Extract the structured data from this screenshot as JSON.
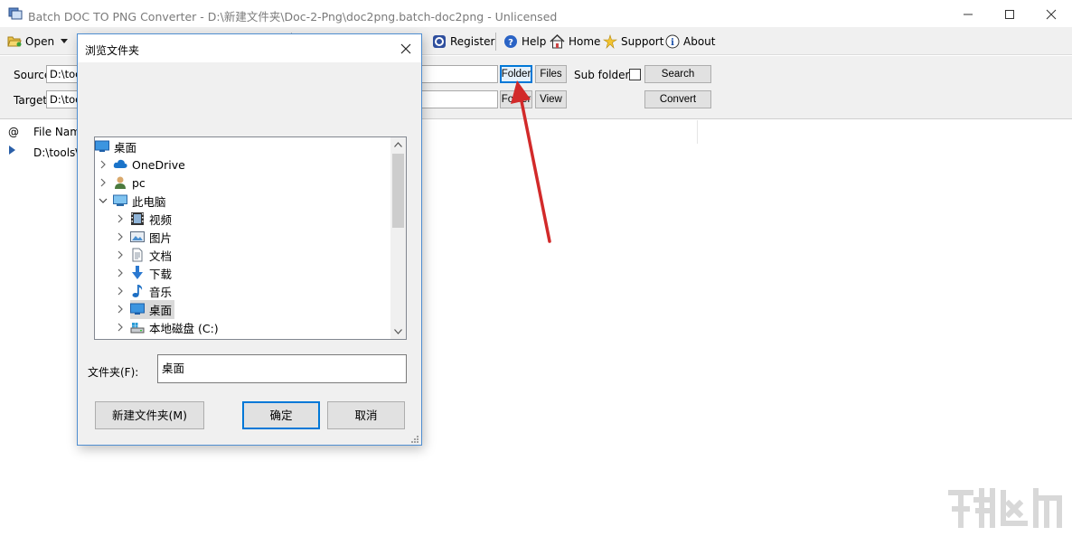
{
  "window": {
    "title": "Batch DOC TO PNG Converter - D:\\新建文件夹\\Doc-2-Png\\doc2png.batch-doc2png - Unlicensed"
  },
  "toolbar": {
    "open_label": "Open",
    "register_label": "Register",
    "help_label": "Help",
    "home_label": "Home",
    "support_label": "Support",
    "about_label": "About"
  },
  "source": {
    "label": "Source",
    "path_value": "D:\\too",
    "folder_button": "Folder",
    "files_button": "Files",
    "subfolders_label": "Sub folders",
    "subfolders_checked": false,
    "search_button": "Search"
  },
  "target": {
    "label": "Target",
    "path_value": "D:\\too",
    "folder_button": "Folder",
    "view_button": "View",
    "convert_button": "Convert"
  },
  "file_list": {
    "columns": [
      "@",
      "File Name"
    ],
    "rows": [
      {
        "name": "D:\\tools\\桌"
      }
    ]
  },
  "dialog": {
    "title": "浏览文件夹",
    "tree": [
      {
        "label": "桌面",
        "icon": "desktop-icon",
        "level": 0
      },
      {
        "label": "OneDrive",
        "icon": "cloud-icon",
        "level": 1
      },
      {
        "label": "pc",
        "icon": "user-icon",
        "level": 1
      },
      {
        "label": "此电脑",
        "icon": "computer-icon",
        "level": 1,
        "expanded": true
      },
      {
        "label": "视频",
        "icon": "video-icon",
        "level": 2
      },
      {
        "label": "图片",
        "icon": "pictures-icon",
        "level": 2
      },
      {
        "label": "文档",
        "icon": "documents-icon",
        "level": 2
      },
      {
        "label": "下载",
        "icon": "download-icon",
        "level": 2
      },
      {
        "label": "音乐",
        "icon": "music-icon",
        "level": 2
      },
      {
        "label": "桌面",
        "icon": "desktop-icon",
        "level": 2,
        "selected": true
      },
      {
        "label": "本地磁盘 (C:)",
        "icon": "drive-icon",
        "level": 2
      }
    ],
    "folder_label": "文件夹(F):",
    "folder_value": "桌面",
    "new_folder_button": "新建文件夹(M)",
    "ok_button": "确定",
    "cancel_button": "取消"
  },
  "colors": {
    "annotation_arrow": "#d22a2a",
    "focus_blue": "#0078d7",
    "toolbar_bg": "#f0f0f0"
  }
}
